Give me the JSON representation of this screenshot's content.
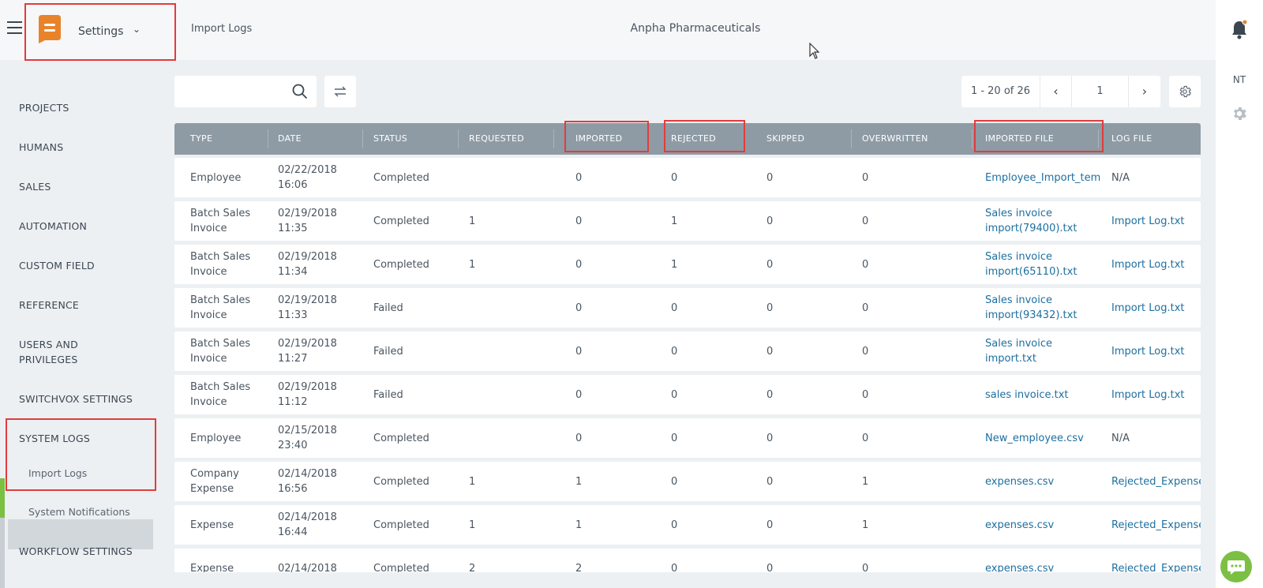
{
  "header": {
    "app_name": "Settings",
    "breadcrumb": "Import Logs",
    "organization": "Anpha Pharmaceuticals"
  },
  "user": {
    "initials": "NT"
  },
  "sidebar": {
    "items": [
      {
        "label": "PROJECTS"
      },
      {
        "label": "HUMANS"
      },
      {
        "label": "SALES"
      },
      {
        "label": "AUTOMATION"
      },
      {
        "label": "CUSTOM FIELD"
      },
      {
        "label": "REFERENCE"
      },
      {
        "label": "USERS AND PRIVILEGES"
      },
      {
        "label": "SWITCHVOX SETTINGS"
      },
      {
        "label": "SYSTEM LOGS"
      }
    ],
    "subitems": [
      {
        "label": "Import Logs",
        "active": true
      },
      {
        "label": "System Notifications"
      }
    ],
    "last_item": {
      "label": "WORKFLOW SETTINGS"
    }
  },
  "toolbar": {
    "search": {
      "placeholder": "",
      "value": ""
    },
    "pager": {
      "range": "1 - 20 of 26",
      "page": "1"
    }
  },
  "table": {
    "columns": [
      "TYPE",
      "DATE",
      "STATUS",
      "REQUESTED",
      "IMPORTED",
      "REJECTED",
      "SKIPPED",
      "OVERWRITTEN",
      "IMPORTED FILE",
      "LOG FILE"
    ],
    "rows": [
      {
        "type": "Employee",
        "date": "02/22/2018 16:06",
        "status": "Completed",
        "requested": "",
        "imported": "0",
        "rejected": "0",
        "skipped": "0",
        "overwritten": "0",
        "imported_file": "Employee_Import_tem",
        "log_file": "N/A"
      },
      {
        "type": "Batch Sales Invoice",
        "date": "02/19/2018 11:35",
        "status": "Completed",
        "requested": "1",
        "imported": "0",
        "rejected": "1",
        "skipped": "0",
        "overwritten": "0",
        "imported_file": "Sales invoice import(79400).txt",
        "log_file": "Import Log.txt"
      },
      {
        "type": "Batch Sales Invoice",
        "date": "02/19/2018 11:34",
        "status": "Completed",
        "requested": "1",
        "imported": "0",
        "rejected": "1",
        "skipped": "0",
        "overwritten": "0",
        "imported_file": "Sales invoice import(65110).txt",
        "log_file": "Import Log.txt"
      },
      {
        "type": "Batch Sales Invoice",
        "date": "02/19/2018 11:33",
        "status": "Failed",
        "requested": "",
        "imported": "0",
        "rejected": "0",
        "skipped": "0",
        "overwritten": "0",
        "imported_file": "Sales invoice import(93432).txt",
        "log_file": "Import Log.txt"
      },
      {
        "type": "Batch Sales Invoice",
        "date": "02/19/2018 11:27",
        "status": "Failed",
        "requested": "",
        "imported": "0",
        "rejected": "0",
        "skipped": "0",
        "overwritten": "0",
        "imported_file": "Sales invoice import.txt",
        "log_file": "Import Log.txt"
      },
      {
        "type": "Batch Sales Invoice",
        "date": "02/19/2018 11:12",
        "status": "Failed",
        "requested": "",
        "imported": "0",
        "rejected": "0",
        "skipped": "0",
        "overwritten": "0",
        "imported_file": "sales invoice.txt",
        "log_file": "Import Log.txt"
      },
      {
        "type": "Employee",
        "date": "02/15/2018 23:40",
        "status": "Completed",
        "requested": "",
        "imported": "0",
        "rejected": "0",
        "skipped": "0",
        "overwritten": "0",
        "imported_file": "New_employee.csv",
        "log_file": "N/A"
      },
      {
        "type": "Company Expense",
        "date": "02/14/2018 16:56",
        "status": "Completed",
        "requested": "1",
        "imported": "1",
        "rejected": "0",
        "skipped": "0",
        "overwritten": "1",
        "imported_file": "expenses.csv",
        "log_file": "Rejected_Expense"
      },
      {
        "type": "Expense",
        "date": "02/14/2018 16:44",
        "status": "Completed",
        "requested": "1",
        "imported": "1",
        "rejected": "0",
        "skipped": "0",
        "overwritten": "1",
        "imported_file": "expenses.csv",
        "log_file": "Rejected_Expense"
      },
      {
        "type": "Expense",
        "date": "02/14/2018",
        "status": "Completed",
        "requested": "2",
        "imported": "2",
        "rejected": "0",
        "skipped": "0",
        "overwritten": "0",
        "imported_file": "expenses.csv",
        "log_file": "Rejected_Expense"
      }
    ]
  },
  "colors": {
    "accent": "#e8832a",
    "highlight": "#e23c3c",
    "link": "#1d6fa0",
    "header": "#8e9ba5",
    "active_marker": "#7bc043"
  },
  "icons": [
    "menu-icon",
    "app-logo",
    "chevron-down-icon",
    "bell-icon",
    "gear-icon",
    "search-icon",
    "swap-icon",
    "chevron-left-icon",
    "chevron-right-icon",
    "chat-icon",
    "mouse-cursor"
  ]
}
